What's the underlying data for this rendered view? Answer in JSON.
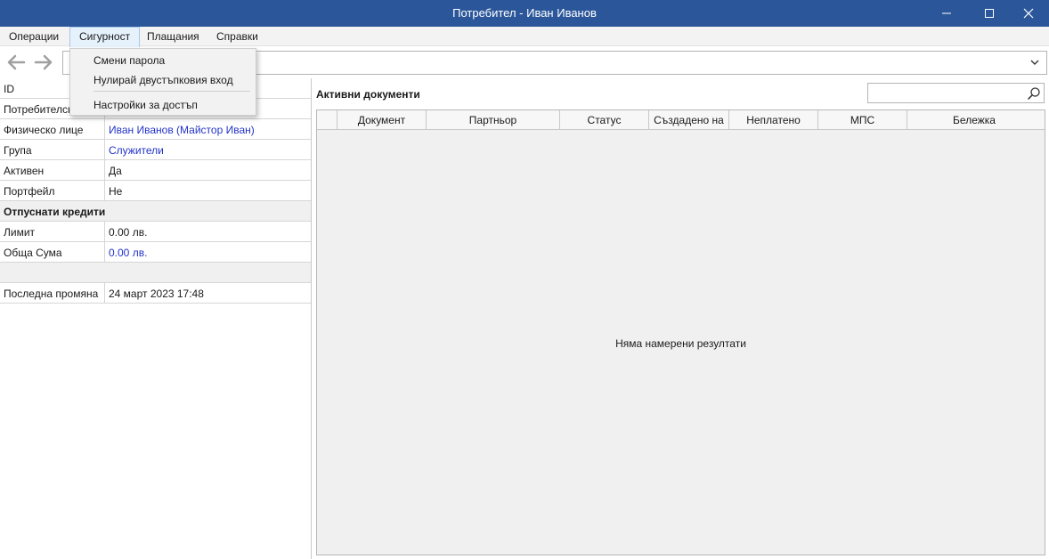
{
  "window": {
    "title": "Потребител - Иван Иванов"
  },
  "menu": {
    "items": [
      "Операции",
      "Сигурност",
      "Плащания",
      "Справки"
    ],
    "security_dropdown": [
      "Смени парола",
      "Нулирай двустъпковия вход",
      "Настройки за достъп"
    ]
  },
  "details": {
    "id_label": "ID",
    "user_label": "Потребителск",
    "person_label": "Физическо лице",
    "person_value": "Иван Иванов (Майстор Иван)",
    "group_label": "Група",
    "group_value": "Служители",
    "active_label": "Активен",
    "active_value": "Да",
    "portfolio_label": "Портфейл",
    "portfolio_value": "Не",
    "credits_section": "Отпуснати кредити",
    "limit_label": "Лимит",
    "limit_value": "0.00 лв.",
    "total_label": "Обща Сума",
    "total_value": "0.00 лв.",
    "last_change_label": "Последна промяна",
    "last_change_value": "24 март 2023 17:48"
  },
  "documents": {
    "title": "Активни документи",
    "search_value": "",
    "columns": [
      "Документ",
      "Партньор",
      "Статус",
      "Създадено на",
      "Неплатено",
      "МПС",
      "Бележка"
    ],
    "empty_message": "Няма намерени резултати"
  },
  "colors": {
    "titlebar": "#2b579a",
    "link": "#2333c8"
  }
}
